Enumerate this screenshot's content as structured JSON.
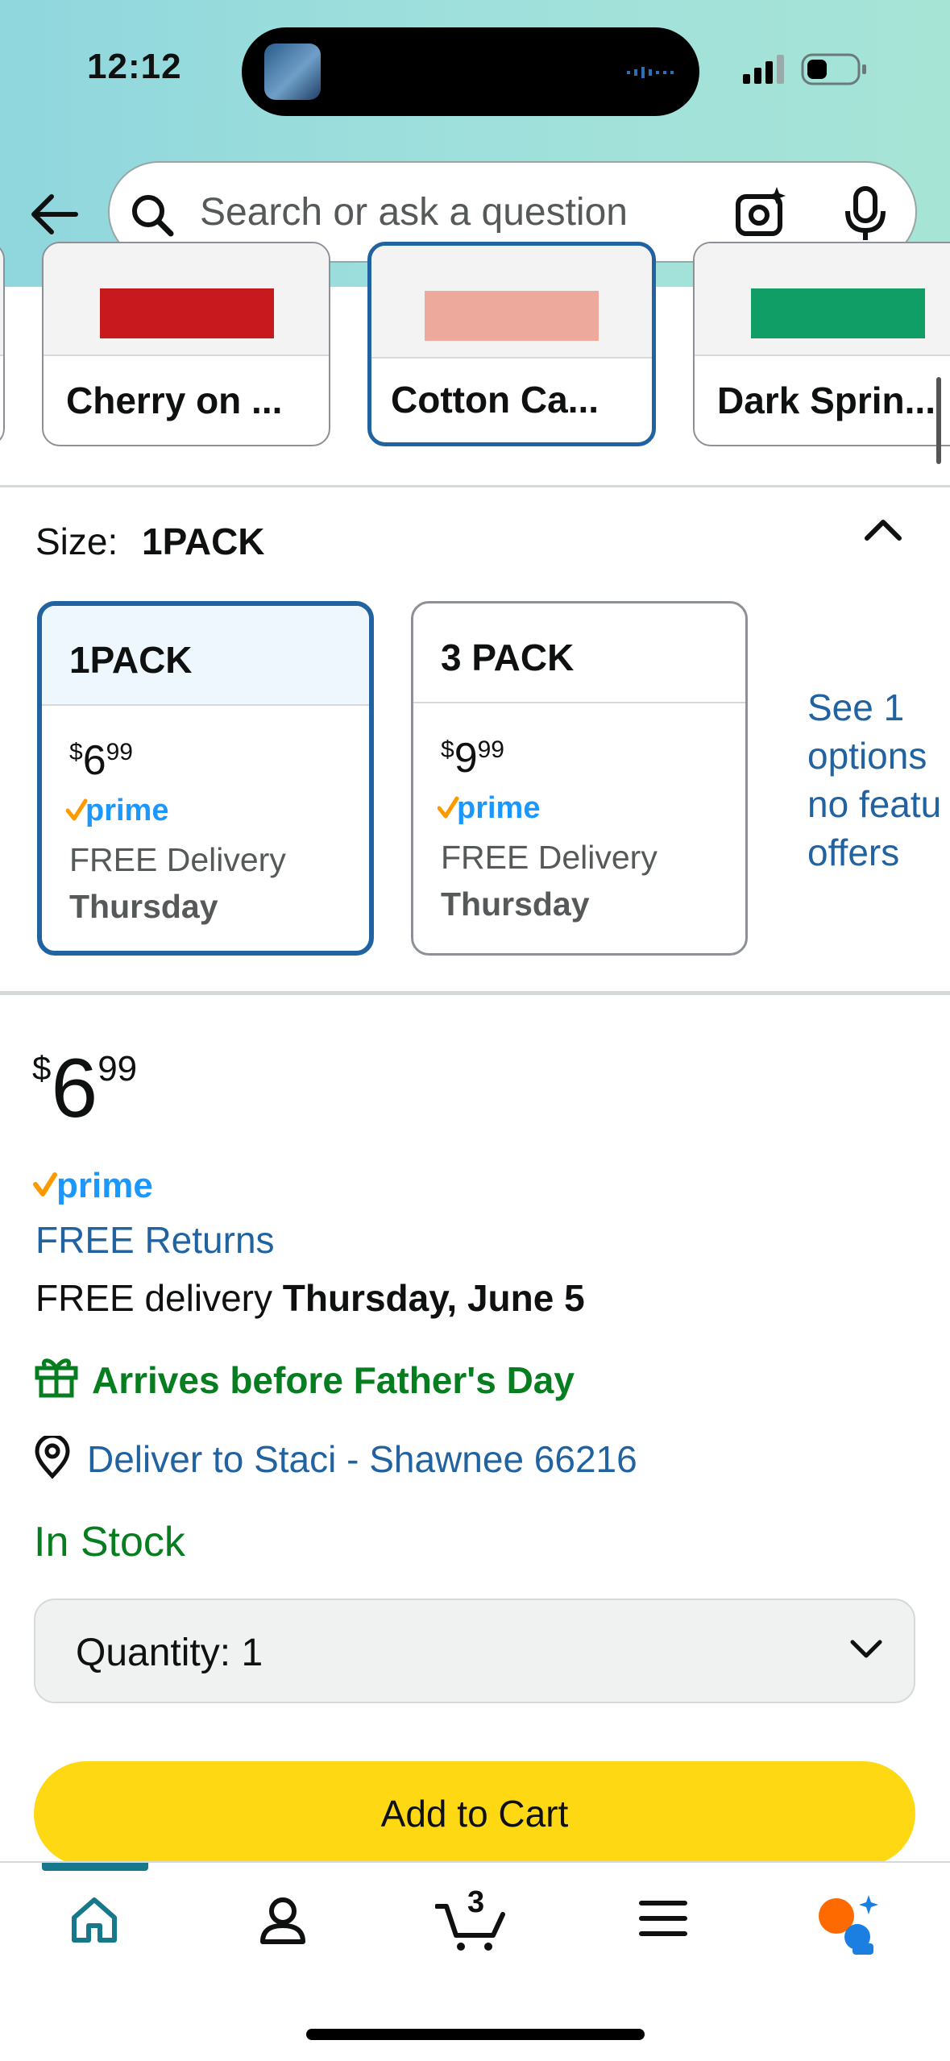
{
  "status_bar": {
    "time": "12:12"
  },
  "search": {
    "placeholder": "Search or ask a question"
  },
  "color_swatches": [
    {
      "label": "Cherry on ...",
      "color": "#c8191f"
    },
    {
      "label": "Cotton Ca...",
      "color": "#eca99c",
      "selected": true
    },
    {
      "label": "Dark Sprin...",
      "color": "#119e66"
    }
  ],
  "size": {
    "label": "Size:",
    "value": "1PACK",
    "options": [
      {
        "title": "1PACK",
        "currency": "$",
        "whole": "6",
        "fraction": "99",
        "prime": "prime",
        "delivery": "FREE Delivery",
        "day": "Thursday",
        "selected": true
      },
      {
        "title": "3 PACK",
        "currency": "$",
        "whole": "9",
        "fraction": "99",
        "prime": "prime",
        "delivery": "FREE Delivery",
        "day": "Thursday"
      }
    ],
    "see_options": [
      "See 1",
      "options",
      "no featu",
      "offers"
    ]
  },
  "price": {
    "currency": "$",
    "whole": "6",
    "fraction": "99"
  },
  "prime_label": "prime",
  "free_returns": "FREE Returns",
  "delivery": {
    "prefix": "FREE delivery",
    "date": "Thursday, June 5"
  },
  "gift_message": "Arrives before Father's Day",
  "deliver_to": "Deliver to Staci - Shawnee 66216",
  "stock": "In Stock",
  "quantity": {
    "label": "Quantity:",
    "value": "1"
  },
  "add_to_cart": "Add to Cart",
  "bottom_nav": {
    "cart_count": "3"
  },
  "colors": {
    "link": "#2162a1",
    "green": "#067d1f",
    "cart_button": "#ffd814",
    "prime_blue": "#1a98ff",
    "prime_check": "#ff9900"
  }
}
